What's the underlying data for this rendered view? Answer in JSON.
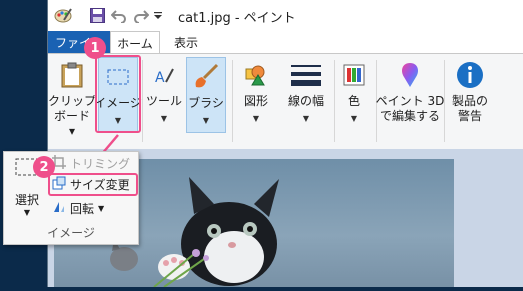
{
  "window": {
    "title": "cat1.jpg - ペイント"
  },
  "quick_access": {
    "icons": [
      "paint-app-icon",
      "save-icon",
      "undo-icon",
      "redo-icon",
      "customize-dropdown-icon"
    ]
  },
  "tabs": [
    {
      "label": "ファイル"
    },
    {
      "label": "ホーム"
    },
    {
      "label": "表示"
    }
  ],
  "ribbon": {
    "clipboard": {
      "line1": "クリップ",
      "line2": "ボード"
    },
    "image": {
      "label": "イメージ"
    },
    "tools": {
      "label": "ツール"
    },
    "brush": {
      "label": "ブラシ"
    },
    "shapes": {
      "label": "図形"
    },
    "line_width": {
      "label": "線の幅"
    },
    "colors": {
      "label": "色"
    },
    "paint3d": {
      "line1": "ペイント 3D",
      "line2": "で編集する"
    },
    "product_alert": {
      "line1": "製品の",
      "line2": "警告"
    }
  },
  "image_dropdown": {
    "select_label": "選択",
    "crop_label": "トリミング",
    "resize_label": "サイズ変更",
    "rotate_label": "回転",
    "group_label": "イメージ"
  },
  "annotations": {
    "step1": "1",
    "step2": "2",
    "color": "#ef4f8b"
  },
  "colors": {
    "accent": "#1a62b3",
    "ribbon_bg": "#f5f6f7",
    "selected_bg": "#cde4f7"
  }
}
